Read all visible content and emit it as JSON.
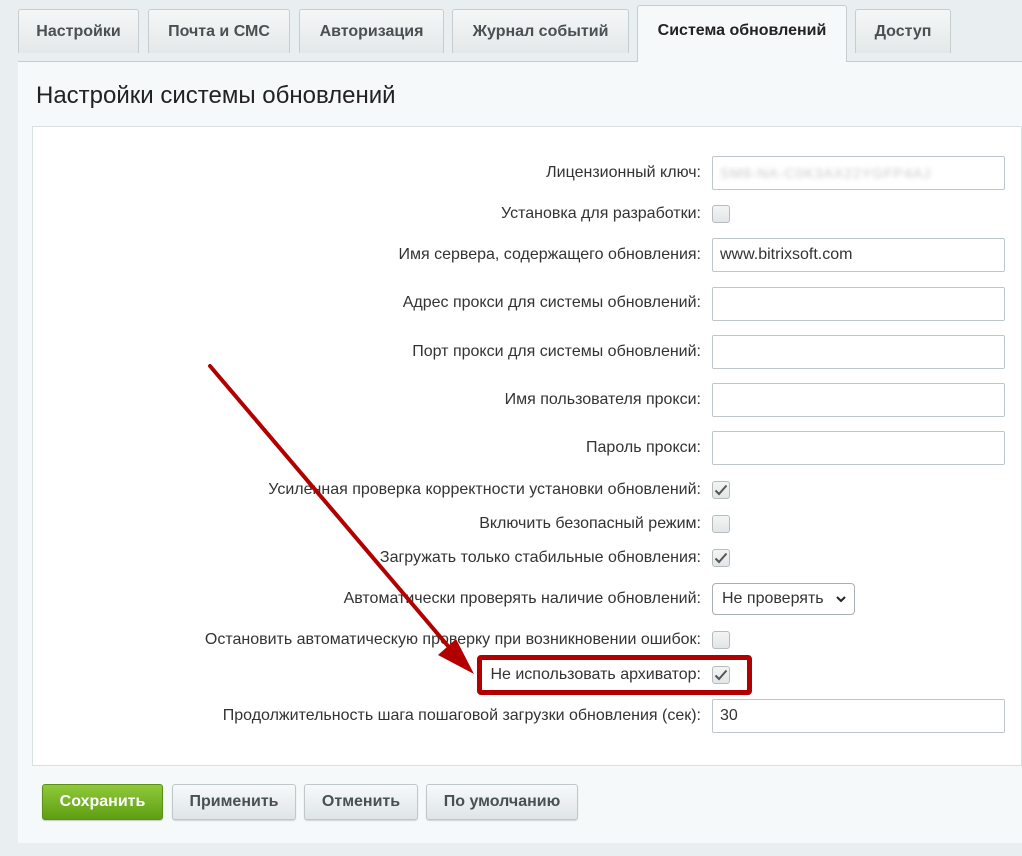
{
  "tabs": [
    {
      "label": "Настройки",
      "active": false
    },
    {
      "label": "Почта и СМС",
      "active": false
    },
    {
      "label": "Авторизация",
      "active": false
    },
    {
      "label": "Журнал событий",
      "active": false
    },
    {
      "label": "Система обновлений",
      "active": true
    },
    {
      "label": "Доступ",
      "active": false
    }
  ],
  "page": {
    "title": "Настройки системы обновлений"
  },
  "form": {
    "license_key": {
      "label": "Лицензионный ключ:",
      "value": "SM8-NA-C0K3AX22YGFP4AJ"
    },
    "dev_install": {
      "label": "Установка для разработки:",
      "checked": false
    },
    "server_name": {
      "label": "Имя сервера, содержащего обновления:",
      "value": "www.bitrixsoft.com"
    },
    "proxy_address": {
      "label": "Адрес прокси для системы обновлений:",
      "value": ""
    },
    "proxy_port": {
      "label": "Порт прокси для системы обновлений:",
      "value": ""
    },
    "proxy_user": {
      "label": "Имя пользователя прокси:",
      "value": ""
    },
    "proxy_password": {
      "label": "Пароль прокси:",
      "value": ""
    },
    "strict_check": {
      "label": "Усиленная проверка корректности установки обновлений:",
      "checked": true
    },
    "safe_mode": {
      "label": "Включить безопасный режим:",
      "checked": false
    },
    "stable_only": {
      "label": "Загружать только стабильные обновления:",
      "checked": true
    },
    "auto_check": {
      "label": "Автоматически проверять наличие обновлений:",
      "selected": "Не проверять"
    },
    "stop_on_error": {
      "label": "Остановить автоматическую проверку при возникновении ошибок:",
      "checked": false
    },
    "no_archiver": {
      "label": "Не использовать архиватор:",
      "checked": true
    },
    "step_duration": {
      "label": "Продолжительность шага пошаговой загрузки обновления (сек):",
      "value": "30"
    }
  },
  "buttons": {
    "save": "Сохранить",
    "apply": "Применить",
    "cancel": "Отменить",
    "default": "По умолчанию"
  },
  "colors": {
    "annotation": "#b20000",
    "save_button": "#6ba81f",
    "panel_bg": "#f5f9f9"
  }
}
